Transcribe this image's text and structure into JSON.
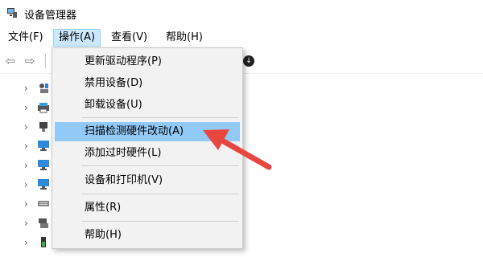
{
  "window": {
    "title": "设备管理器",
    "icon": "device-manager-icon"
  },
  "menubar": {
    "items": [
      {
        "label": "文件(F)"
      },
      {
        "label": "操作(A)"
      },
      {
        "label": "查看(V)"
      },
      {
        "label": "帮助(H)"
      }
    ]
  },
  "toolbar": {
    "back_icon": "back-arrow-icon",
    "forward_icon": "forward-arrow-icon",
    "extra_icon": "download-icon"
  },
  "dropdown": {
    "items": [
      {
        "label": "更新驱动程序(P)"
      },
      {
        "label": "禁用设备(D)"
      },
      {
        "label": "卸载设备(U)"
      },
      {
        "label": "扫描检测硬件改动(A)",
        "highlighted": true
      },
      {
        "label": "添加过时硬件(L)"
      },
      {
        "label": "设备和打印机(V)"
      },
      {
        "label": "属性(R)"
      },
      {
        "label": "帮助(H)"
      }
    ]
  },
  "tree": {
    "icons": [
      "audio-device-icon",
      "printer-icon",
      "usb-plug-icon",
      "monitor-icon",
      "monitor-icon",
      "monitor-icon",
      "keyboard-icon",
      "network-adapter-icon",
      "battery-icon",
      "computer-icon"
    ]
  },
  "colors": {
    "highlight": "#91c9f7",
    "menu_active": "#cce8ff",
    "annotation_arrow": "#e8473f"
  }
}
